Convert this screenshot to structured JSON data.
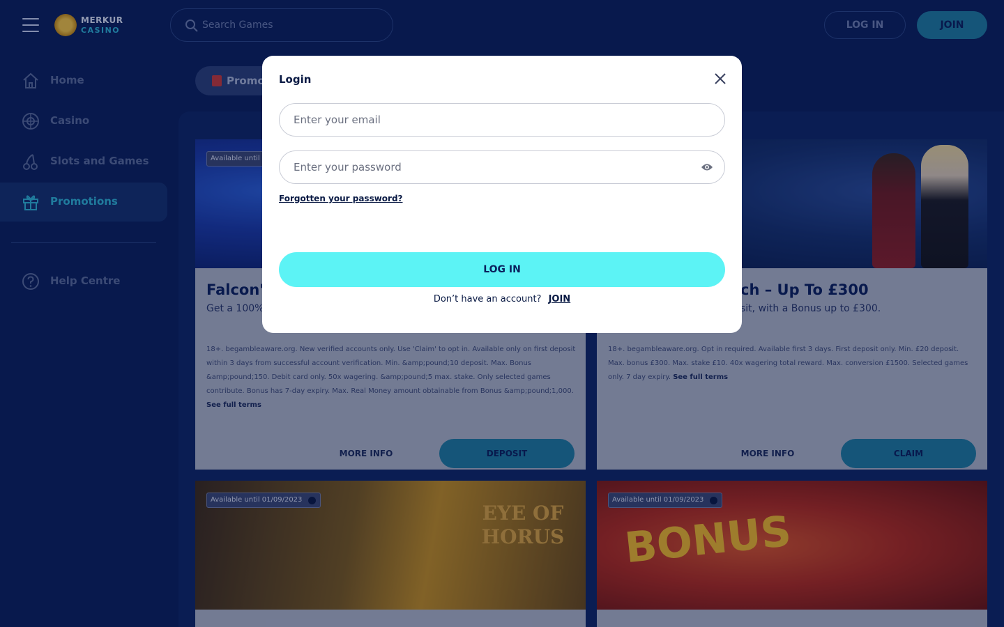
{
  "header": {
    "logo_line1": "MERKUR",
    "logo_line2": "CASINO",
    "search_placeholder": "Search Games",
    "login_label": "LOG IN",
    "join_label": "JOIN"
  },
  "sidebar": {
    "items": [
      {
        "label": "Home",
        "icon": "home-icon"
      },
      {
        "label": "Casino",
        "icon": "roulette-icon"
      },
      {
        "label": "Slots and Games",
        "icon": "cherries-icon"
      },
      {
        "label": "Promotions",
        "icon": "gift-icon",
        "active": true
      },
      {
        "label": "Help Centre",
        "icon": "help-icon"
      }
    ]
  },
  "main": {
    "promo_pill_label": "Promot",
    "cards": [
      {
        "badge": "Available until",
        "title": "Falcon's",
        "subtitle": "Get a 100%",
        "terms": "18+. begambleaware.org. New verified accounts only. Use 'Claim' to opt in. Available only on first deposit within 3 days from successful account verification. Min. &amp;pound;10 deposit. Max. Bonus &amp;pound;150. Debit card only. 50x wagering. &amp;pound;5 max. stake. Only selected games contribute. Bonus has 7-day expiry. Max. Real Money amount obtainable from Bonus &amp;pound;1,000.",
        "terms_link": "See full terms",
        "more_label": "MORE INFO",
        "cta_label": "DEPOSIT"
      },
      {
        "title": "ch – Up To £300",
        "subtitle": "sit, with a Bonus up to £300.",
        "terms": "18+. begambleaware.org. Opt in required. Available first 3 days. First deposit only. Min. £20 deposit. Max. bonus £300. Max. stake £10. 40x wagering total reward. Max. conversion £1500. Selected games only. 7 day expiry.",
        "terms_link": "See full terms",
        "more_label": "MORE INFO",
        "cta_label": "CLAIM"
      },
      {
        "badge": "Available until 01/09/2023",
        "image_text": "EYE OF HORUS"
      },
      {
        "badge": "Available until 01/09/2023",
        "image_text": "BONUS"
      }
    ]
  },
  "modal": {
    "title": "Login",
    "email_placeholder": "Enter your email",
    "password_placeholder": "Enter your password",
    "forgot_label": "Forgotten your password?",
    "login_label": "LOG IN",
    "no_account_text": "Don’t have an account?",
    "join_label": "JOIN"
  }
}
